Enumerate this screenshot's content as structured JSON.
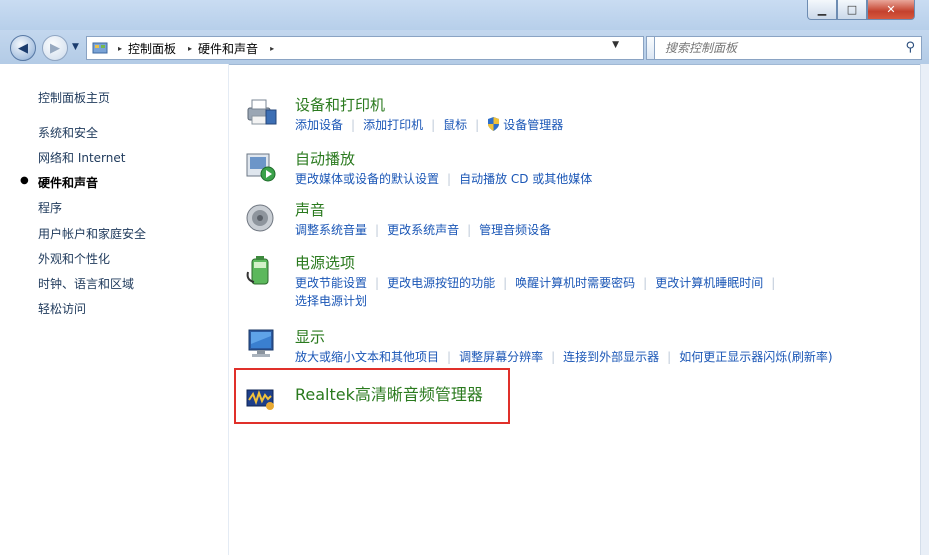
{
  "window": {
    "minimize": "▁",
    "maximize": "□",
    "close": "✕"
  },
  "address": {
    "segments": [
      "控制面板",
      "硬件和声音"
    ],
    "separator": "▸"
  },
  "search": {
    "placeholder": "搜索控制面板"
  },
  "sidebar": {
    "items": [
      {
        "label": "控制面板主页"
      },
      {
        "label": "系统和安全"
      },
      {
        "label": "网络和 Internet"
      },
      {
        "label": "硬件和声音",
        "active": true
      },
      {
        "label": "程序"
      },
      {
        "label": "用户帐户和家庭安全"
      },
      {
        "label": "外观和个性化"
      },
      {
        "label": "时钟、语言和区域"
      },
      {
        "label": "轻松访问"
      }
    ]
  },
  "categories": [
    {
      "title": "设备和打印机",
      "icon": "printer-icon",
      "links": [
        "添加设备",
        "添加打印机",
        "鼠标",
        "设备管理器"
      ]
    },
    {
      "title": "自动播放",
      "icon": "autoplay-icon",
      "links": [
        "更改媒体或设备的默认设置",
        "自动播放 CD 或其他媒体"
      ]
    },
    {
      "title": "声音",
      "icon": "speaker-icon",
      "links": [
        "调整系统音量",
        "更改系统声音",
        "管理音频设备"
      ]
    },
    {
      "title": "电源选项",
      "icon": "battery-icon",
      "links": [
        "更改节能设置",
        "更改电源按钮的功能",
        "唤醒计算机时需要密码",
        "更改计算机睡眠时间",
        "选择电源计划"
      ]
    },
    {
      "title": "显示",
      "icon": "display-icon",
      "links": [
        "放大或缩小文本和其他项目",
        "调整屏幕分辨率",
        "连接到外部显示器",
        "如何更正显示器闪烁(刷新率)"
      ]
    },
    {
      "title": "Realtek高清晰音频管理器",
      "icon": "realtek-audio-icon",
      "links": []
    }
  ],
  "colors": {
    "accent_green": "#2a7a1e",
    "link_blue": "#1a56b6",
    "highlight_red": "#e0302a"
  }
}
